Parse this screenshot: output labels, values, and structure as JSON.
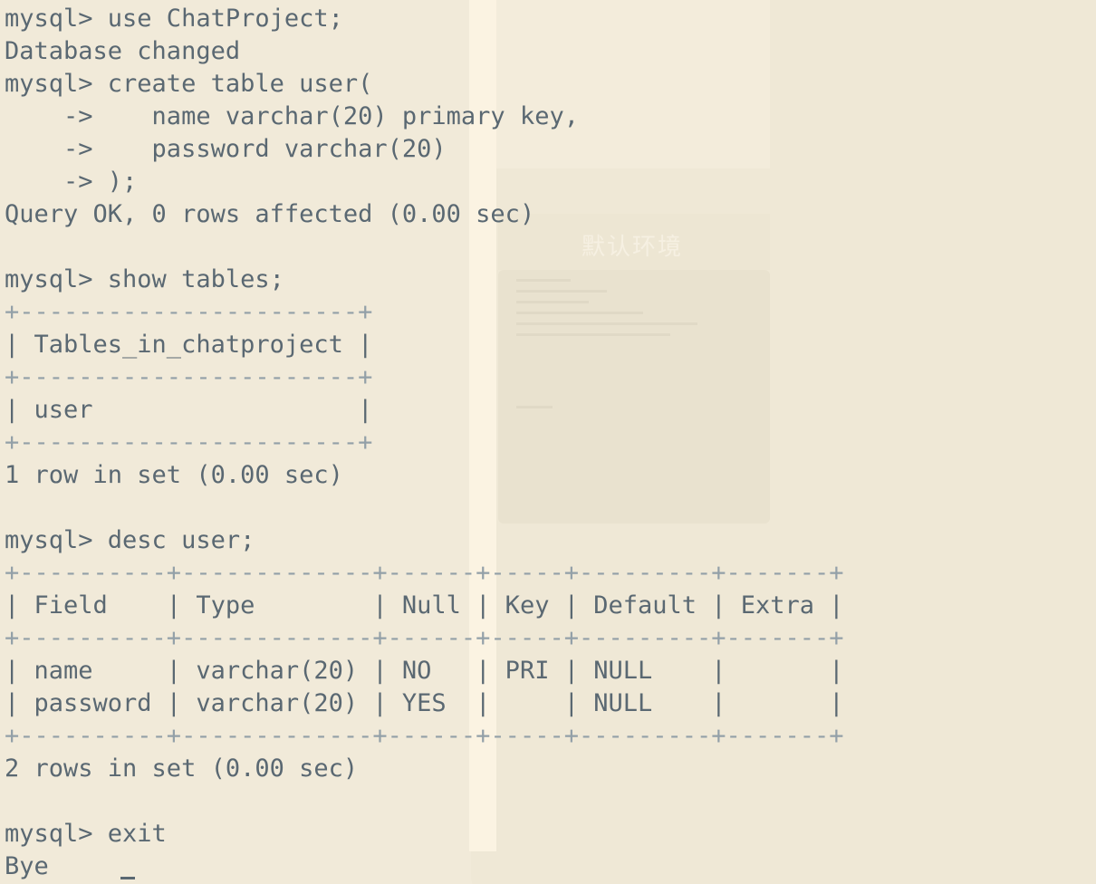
{
  "background": {
    "window_label": "默认环境",
    "chevron": "‹"
  },
  "terminal": {
    "lines": [
      "mysql> use ChatProject;",
      "Database changed",
      "mysql> create table user(",
      "    ->    name varchar(20) primary key,",
      "    ->    password varchar(20)",
      "    -> );",
      "Query OK, 0 rows affected (0.00 sec)",
      "",
      "mysql> show tables;",
      "+-----------------------+",
      "| Tables_in_chatproject |",
      "+-----------------------+",
      "| user                  |",
      "+-----------------------+",
      "1 row in set (0.00 sec)",
      "",
      "mysql> desc user;",
      "+----------+-------------+------+-----+---------+-------+",
      "| Field    | Type        | Null | Key | Default | Extra |",
      "+----------+-------------+------+-----+---------+-------+",
      "| name     | varchar(20) | NO   | PRI | NULL    |       |",
      "| password | varchar(20) | YES  |     | NULL    |       |",
      "+----------+-------------+------+-----+---------+-------+",
      "2 rows in set (0.00 sec)",
      "",
      "mysql> exit",
      "Bye"
    ],
    "border_lines": [
      9,
      11,
      13,
      17,
      19,
      22
    ]
  },
  "colors": {
    "background": "#f1ead9",
    "text": "#5a6872",
    "table_border": "#93a0a8"
  }
}
